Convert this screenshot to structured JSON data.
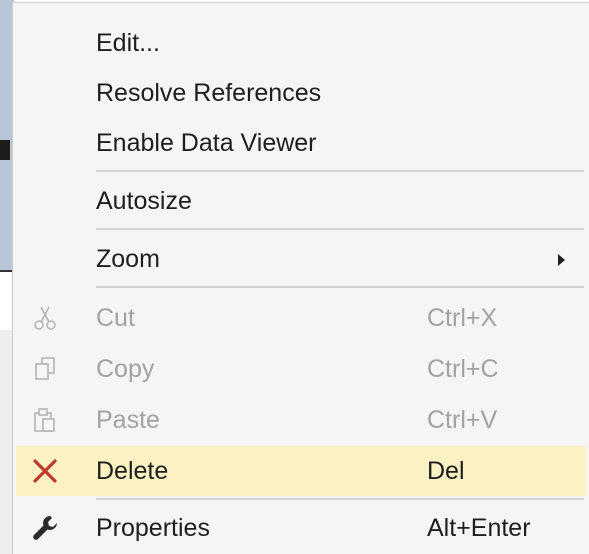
{
  "menu": {
    "items": [
      {
        "label": "Edit..."
      },
      {
        "label": "Resolve References"
      },
      {
        "label": "Enable Data Viewer"
      },
      {
        "label": "Autosize"
      },
      {
        "label": "Zoom",
        "has_submenu": true
      },
      {
        "label": "Cut",
        "shortcut": "Ctrl+X",
        "icon": "scissors-icon",
        "disabled": true
      },
      {
        "label": "Copy",
        "shortcut": "Ctrl+C",
        "icon": "copy-icon",
        "disabled": true
      },
      {
        "label": "Paste",
        "shortcut": "Ctrl+V",
        "icon": "paste-icon",
        "disabled": true
      },
      {
        "label": "Delete",
        "shortcut": "Del",
        "icon": "delete-x-icon",
        "highlighted": true
      },
      {
        "label": "Properties",
        "shortcut": "Alt+Enter",
        "icon": "wrench-icon"
      }
    ]
  },
  "colors": {
    "menu_background": "#f5f5f5",
    "highlight": "#fcf1c2",
    "text": "#1e1e1e",
    "disabled_text": "#a2a2a2",
    "delete_icon": "#c0392b",
    "separator": "#d2d2d2"
  }
}
